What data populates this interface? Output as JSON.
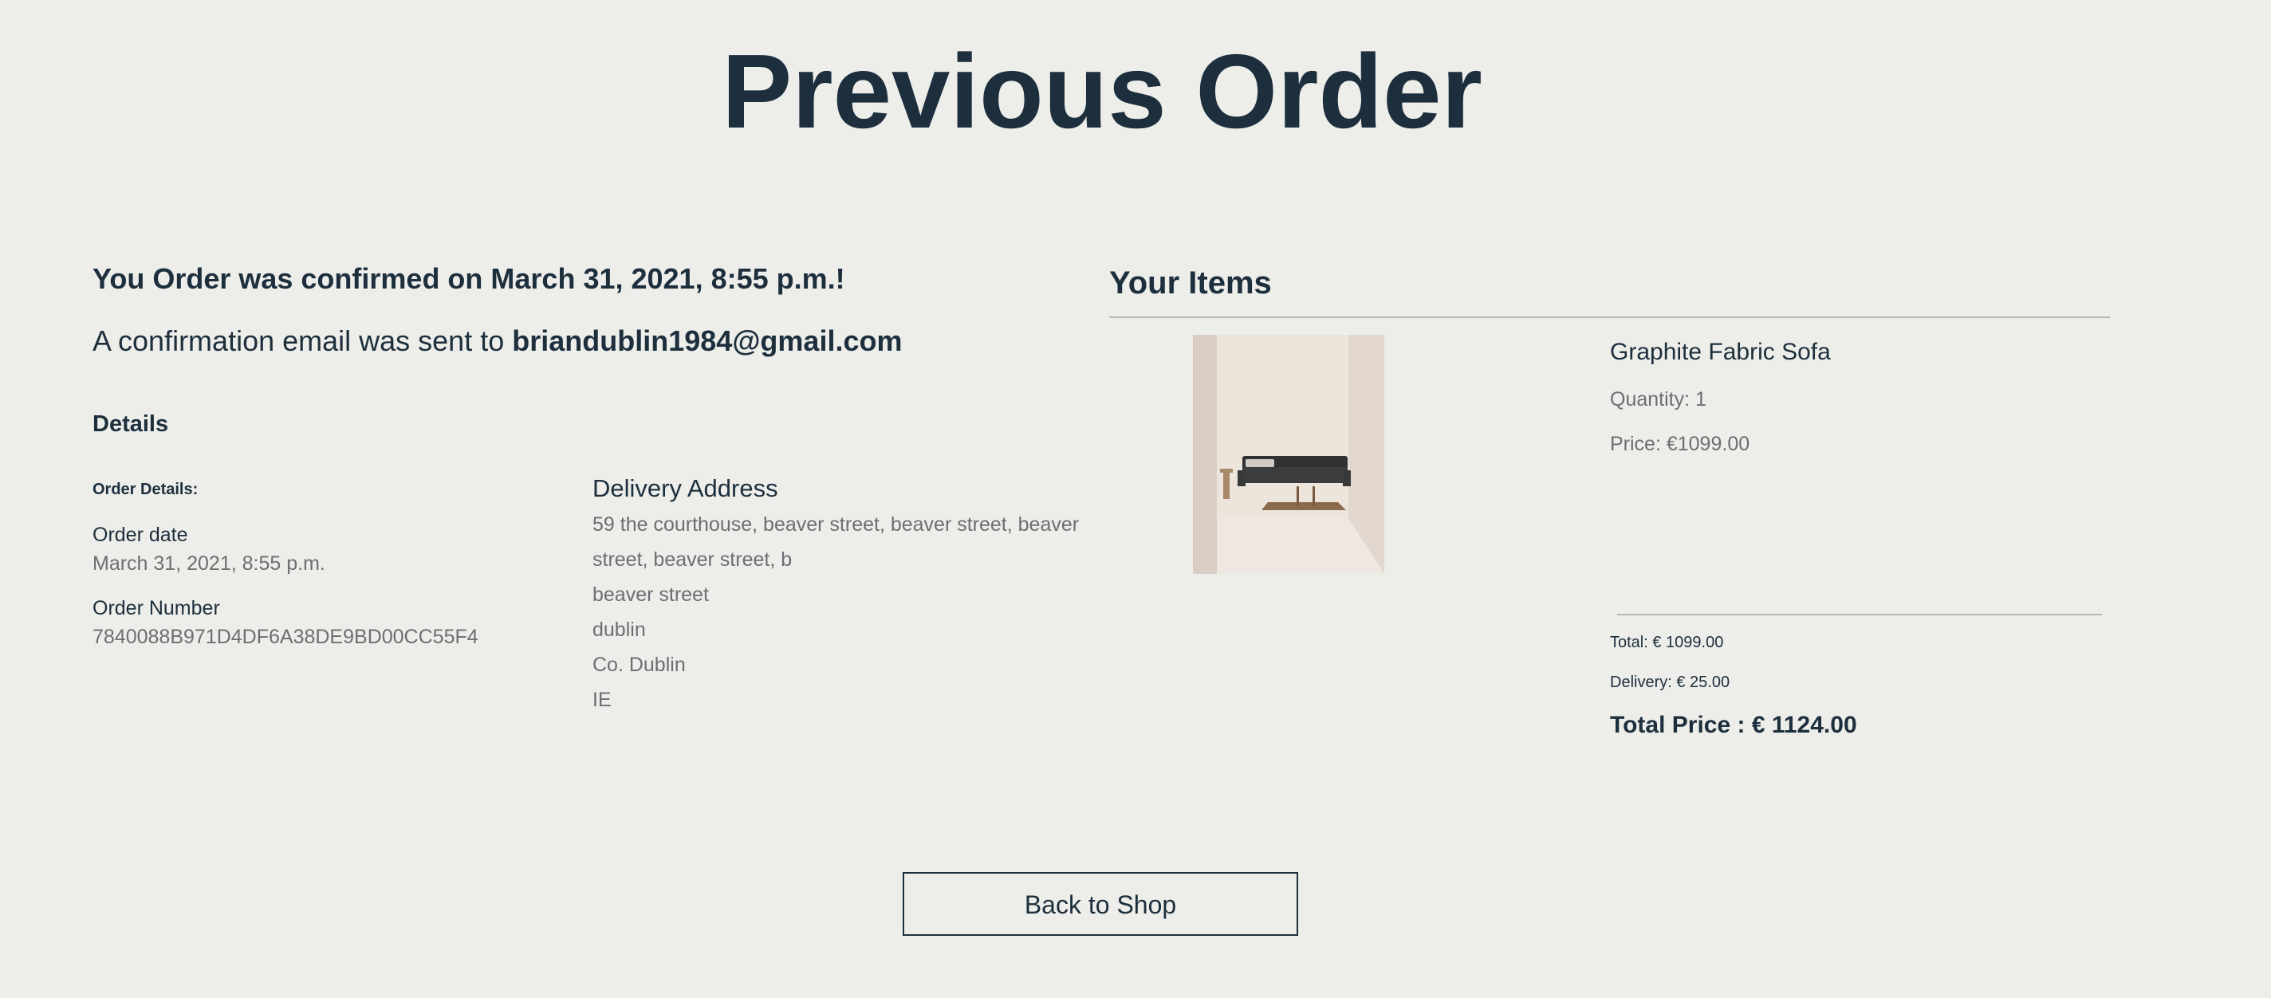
{
  "page": {
    "title": "Previous Order"
  },
  "confirmation": {
    "heading": "You Order was confirmed on March 31, 2021, 8:55 p.m.!",
    "email_prefix": "A confirmation email was sent to",
    "email": "briandublin1984@gmail.com"
  },
  "details": {
    "heading": "Details",
    "order_details_label": "Order Details:",
    "order_date_label": "Order date",
    "order_date_value": "March 31, 2021, 8:55 p.m.",
    "order_number_label": "Order Number",
    "order_number_value": "7840088B971D4DF6A38DE9BD00CC55F4"
  },
  "delivery": {
    "heading": "Delivery Address",
    "lines": [
      "59 the courthouse, beaver street, beaver street, beaver street, beaver street, b",
      "beaver street",
      "dublin",
      "Co. Dublin",
      "IE"
    ]
  },
  "items": {
    "heading": "Your Items",
    "list": [
      {
        "name": "Graphite Fabric Sofa",
        "quantity": "Quantity: 1",
        "price": "Price: €1099.00"
      }
    ]
  },
  "totals": {
    "subtotal": "Total: € 1099.00",
    "delivery": "Delivery: € 25.00",
    "total_price": "Total Price : € 1124.00"
  },
  "actions": {
    "back_label": "Back to Shop"
  },
  "colors": {
    "background": "#ededea",
    "text_primary": "#1d2f3d",
    "text_muted": "#6b6f72"
  }
}
